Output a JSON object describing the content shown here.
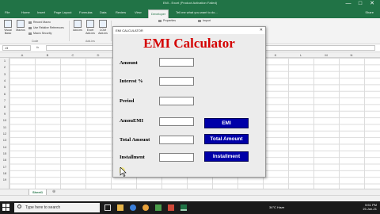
{
  "window": {
    "title": "EMI - Excel (Product Activation Failed)",
    "controls": [
      "—",
      "□",
      "✕"
    ]
  },
  "ribbon_tabs": [
    "File",
    "Home",
    "Insert",
    "Page Layout",
    "Formulas",
    "Data",
    "Review",
    "View",
    "Developer"
  ],
  "active_tab": "Developer",
  "tell_me": "Tell me what you want to do...",
  "share": "Share",
  "ribbon": {
    "visual_basic": "Visual Basic",
    "macros": "Macros",
    "record_macro": "Record Macro",
    "relative_refs": "Use Relative References",
    "macro_security": "Macro Security",
    "code_group": "Code",
    "addins": "Add-ins",
    "excel_addins": "Excel Add-ins",
    "com_addins": "COM Add-ins",
    "addins_group": "Add-ins",
    "properties": "Properties",
    "import": "Import"
  },
  "formula_bar": {
    "name_box": "J3",
    "fx": "fx",
    "value": ""
  },
  "columns": [
    "A",
    "B",
    "C",
    "D",
    "E",
    "F",
    "G",
    "H",
    "I",
    "J",
    "K",
    "L",
    "M",
    "N"
  ],
  "rows": [
    "1",
    "2",
    "3",
    "4",
    "5",
    "6",
    "7",
    "8",
    "9",
    "10",
    "11",
    "12",
    "13",
    "14",
    "15",
    "16",
    "17",
    "18",
    "19"
  ],
  "sheet_tab": "Sheet1",
  "dialog": {
    "title": "EMI CALCULATOR",
    "heading": "EMI Calculator",
    "labels": {
      "amount": "Amount",
      "interest": "Interest %",
      "period": "Period",
      "amount_emi": "AmouEMI",
      "total_amount": "Total Amount",
      "installment": "Installment"
    },
    "buttons": {
      "emi": "EMI",
      "total_amount": "Total Amount",
      "installment": "Installment"
    },
    "colors": {
      "heading": "#d40000",
      "button": "#0000a8",
      "button_text": "#ffffff"
    }
  },
  "taskbar": {
    "search_placeholder": "Type here to search",
    "weather": "34°C Haze",
    "time": "5:51 PM",
    "date": "19-Jun-21"
  }
}
